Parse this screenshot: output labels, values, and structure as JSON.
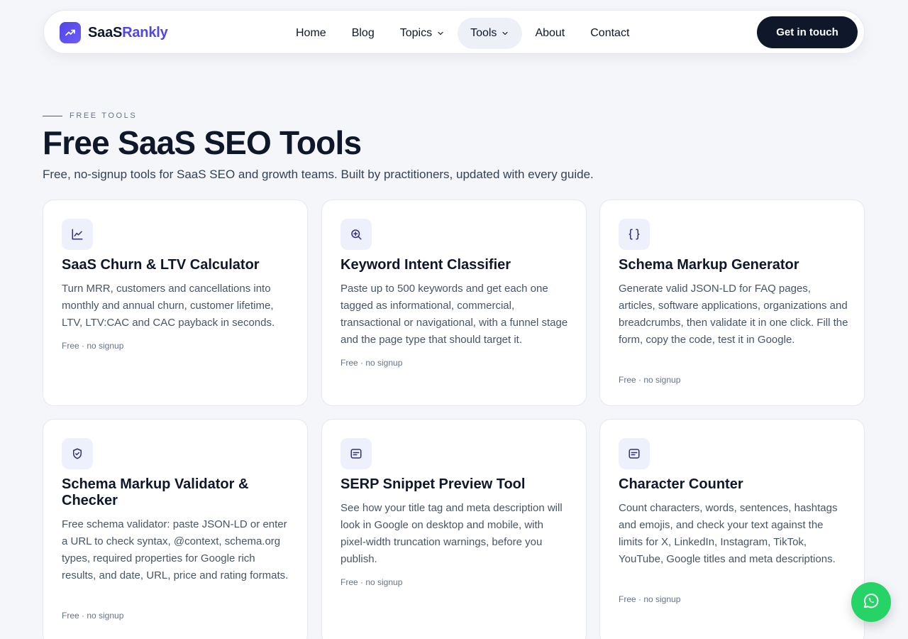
{
  "nav": {
    "brand_a": "SaaS",
    "brand_b": "Rankly",
    "items": [
      {
        "label": "Home"
      },
      {
        "label": "Blog"
      },
      {
        "label": "Topics"
      },
      {
        "label": "Tools"
      },
      {
        "label": "About"
      },
      {
        "label": "Contact"
      }
    ],
    "cta": "Get in touch"
  },
  "hero": {
    "eyebrow": "FREE TOOLS",
    "title": "Free SaaS SEO Tools",
    "subtitle": "Free, no-signup tools for SaaS SEO and growth teams. Built by practitioners, updated with every guide."
  },
  "cards": [
    {
      "icon": "line-chart-icon",
      "title": "SaaS Churn & LTV Calculator",
      "desc": "Turn MRR, customers and cancellations into monthly and annual churn, customer lifetime, LTV, LTV:CAC and CAC payback in seconds.",
      "meta": "Free · no signup"
    },
    {
      "icon": "zoom-in-icon",
      "title": "Keyword Intent Classifier",
      "desc": "Paste up to 500 keywords and get each one tagged as informational, commercial, transactional or navigational, with a funnel stage and the page type that should target it.",
      "meta": "Free · no signup"
    },
    {
      "icon": "braces-icon",
      "title": "Schema Markup Generator",
      "desc": "Generate valid JSON-LD for FAQ pages, articles, software applications, organizations and breadcrumbs, then validate it in one click. Fill the form, copy the code, test it in Google.",
      "meta": "Free · no signup"
    },
    {
      "icon": "shield-check-icon",
      "title": "Schema Markup Validator & Checker",
      "desc": "Free schema validator: paste JSON-LD or enter a URL to check syntax, @context, schema.org types, required properties for Google rich results, and date, URL, price and rating formats.",
      "meta": "Free · no signup"
    },
    {
      "icon": "message-square-icon",
      "title": "SERP Snippet Preview Tool",
      "desc": "See how your title tag and meta description will look in Google on desktop and mobile, with pixel-width truncation warnings, before you publish.",
      "meta": "Free · no signup"
    },
    {
      "icon": "message-square-icon",
      "title": "Character Counter",
      "desc": "Count characters, words, sentences, hashtags and emojis, and check your text against the limits for X, LinkedIn, Instagram, TikTok, YouTube, Google titles and meta descriptions.",
      "meta": "Free · no signup"
    }
  ],
  "colors": {
    "accent": "#4f46e5",
    "dark": "#0f172a",
    "whatsapp": "#25d366"
  }
}
